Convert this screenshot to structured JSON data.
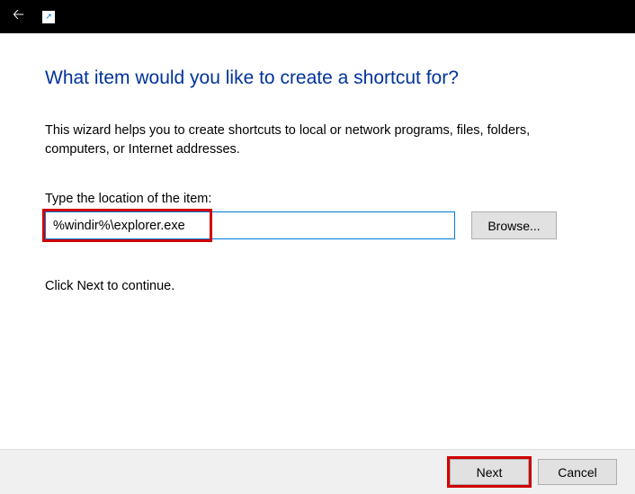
{
  "heading": "What item would you like to create a shortcut for?",
  "description": "This wizard helps you to create shortcuts to local or network programs, files, folders, computers, or Internet addresses.",
  "field_label": "Type the location of the item:",
  "location_value": "%windir%\\explorer.exe",
  "browse_label": "Browse...",
  "continue_text": "Click Next to continue.",
  "footer": {
    "next_label": "Next",
    "cancel_label": "Cancel"
  }
}
